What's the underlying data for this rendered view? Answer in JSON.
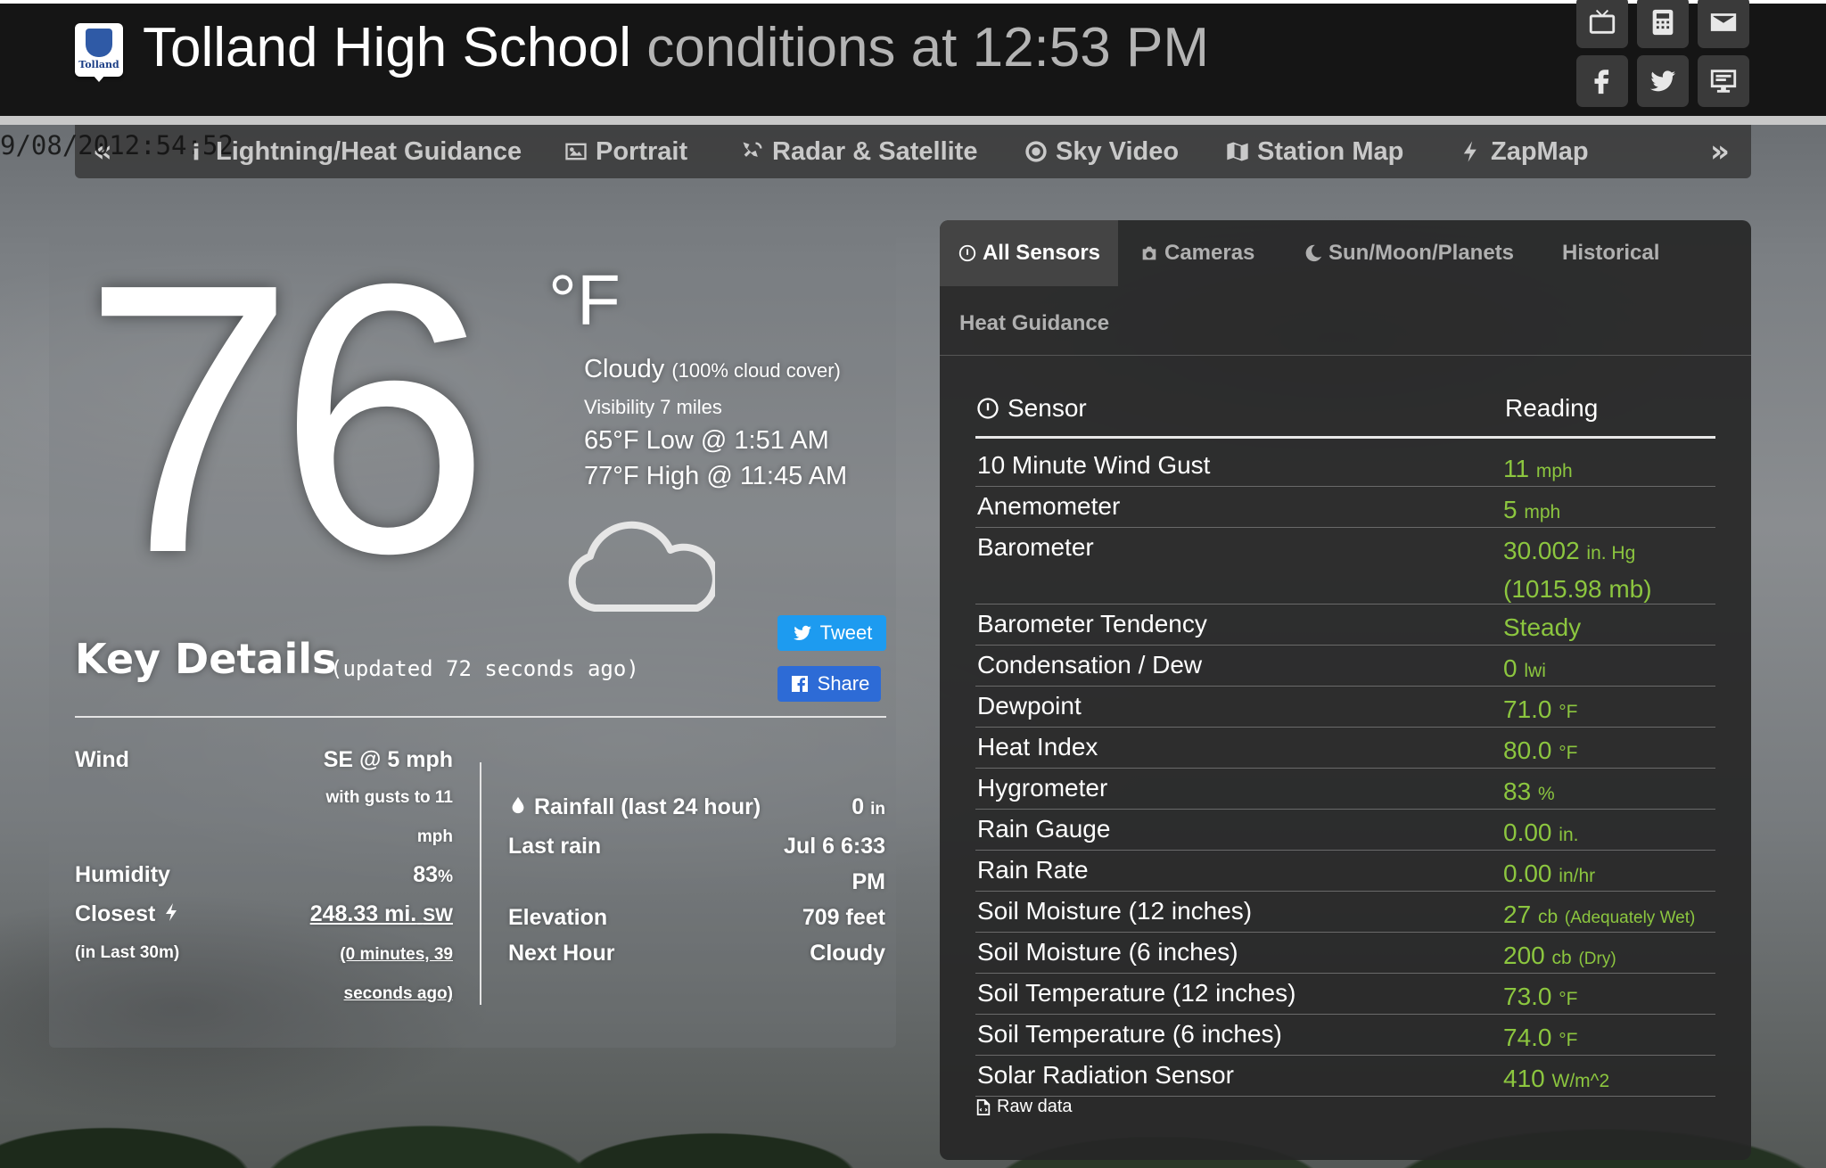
{
  "header": {
    "school_name": "Tolland High School",
    "conditions_text": "conditions at 12:53 PM",
    "logo_text": "Tolland",
    "icons": [
      "tv-icon",
      "calculator-icon",
      "envelope-icon",
      "facebook-icon",
      "twitter-icon",
      "desktop-icon"
    ]
  },
  "nav": {
    "clock": "9/08/2012:54:52",
    "items": [
      "Lightning/Heat Guidance",
      "Portrait",
      "Radar & Satellite",
      "Sky Video",
      "Station Map",
      "ZapMap"
    ]
  },
  "current": {
    "temperature": "76",
    "unit": "°F",
    "condition": "Cloudy",
    "cloud_cover": "(100% cloud cover)",
    "visibility": "Visibility 7 miles",
    "low": "65°F Low @ 1:51 AM",
    "high": "77°F High @ 11:45 AM"
  },
  "social": {
    "tweet": "Tweet",
    "share": "Share"
  },
  "key_details": {
    "title": "Key Details",
    "updated": "(updated 72 seconds ago)",
    "wind_label": "Wind",
    "wind_value": "SE @ 5 mph",
    "wind_gust_1": "with gusts to 11",
    "wind_gust_2": "mph",
    "humidity_label": "Humidity",
    "humidity_value": "83",
    "humidity_unit": "%",
    "closest_label": "Closest",
    "closest_value": "248.33 mi.",
    "closest_dir": "SW",
    "closest_sub": "(in Last 30m)",
    "closest_ago_1": "(0 minutes, 39",
    "closest_ago_2": "seconds ago)",
    "rain_label": "Rainfall (last 24 hour)",
    "rain_value": "0",
    "rain_unit": "in",
    "lastrain_label": "Last rain",
    "lastrain_value_1": "Jul 6 6:33",
    "lastrain_value_2": "PM",
    "elev_label": "Elevation",
    "elev_value": "709 feet",
    "next_label": "Next Hour",
    "next_value": "Cloudy"
  },
  "tabs": [
    "All Sensors",
    "Cameras",
    "Sun/Moon/Planets",
    "Historical",
    "Heat Guidance"
  ],
  "sensors": {
    "header_sensor": "Sensor",
    "header_reading": "Reading",
    "raw_data": "Raw data",
    "rows": [
      {
        "name": "10 Minute Wind Gust",
        "value": "11",
        "unit": "mph",
        "extra": ""
      },
      {
        "name": "Anemometer",
        "value": "5",
        "unit": "mph",
        "extra": ""
      },
      {
        "name": "Barometer",
        "value": "30.002",
        "unit": "in. Hg",
        "extra": "(1015.98 mb)"
      },
      {
        "name": "Barometer Tendency",
        "value": "Steady",
        "unit": "",
        "extra": ""
      },
      {
        "name": "Condensation / Dew",
        "value": "0",
        "unit": "lwi",
        "extra": ""
      },
      {
        "name": "Dewpoint",
        "value": "71.0",
        "unit": "°F",
        "extra": ""
      },
      {
        "name": "Heat Index",
        "value": "80.0",
        "unit": "°F",
        "extra": ""
      },
      {
        "name": "Hygrometer",
        "value": "83",
        "unit": "%",
        "extra": ""
      },
      {
        "name": "Rain Gauge",
        "value": "0.00",
        "unit": "in.",
        "extra": ""
      },
      {
        "name": "Rain Rate",
        "value": "0.00",
        "unit": "in/hr",
        "extra": ""
      },
      {
        "name": "Soil Moisture (12 inches)",
        "value": "27",
        "unit": "cb",
        "note": "(Adequately Wet)",
        "extra": ""
      },
      {
        "name": "Soil Moisture (6 inches)",
        "value": "200",
        "unit": "cb",
        "note": "(Dry)",
        "extra": ""
      },
      {
        "name": "Soil Temperature (12 inches)",
        "value": "73.0",
        "unit": "°F",
        "extra": ""
      },
      {
        "name": "Soil Temperature (6 inches)",
        "value": "74.0",
        "unit": "°F",
        "extra": ""
      },
      {
        "name": "Solar Radiation Sensor",
        "value": "410",
        "unit": "W/m^2",
        "extra": ""
      }
    ]
  },
  "colors": {
    "reading_green": "#8cc63f",
    "tweet_blue": "#1d9bf0",
    "share_blue": "#2d6bd6"
  }
}
